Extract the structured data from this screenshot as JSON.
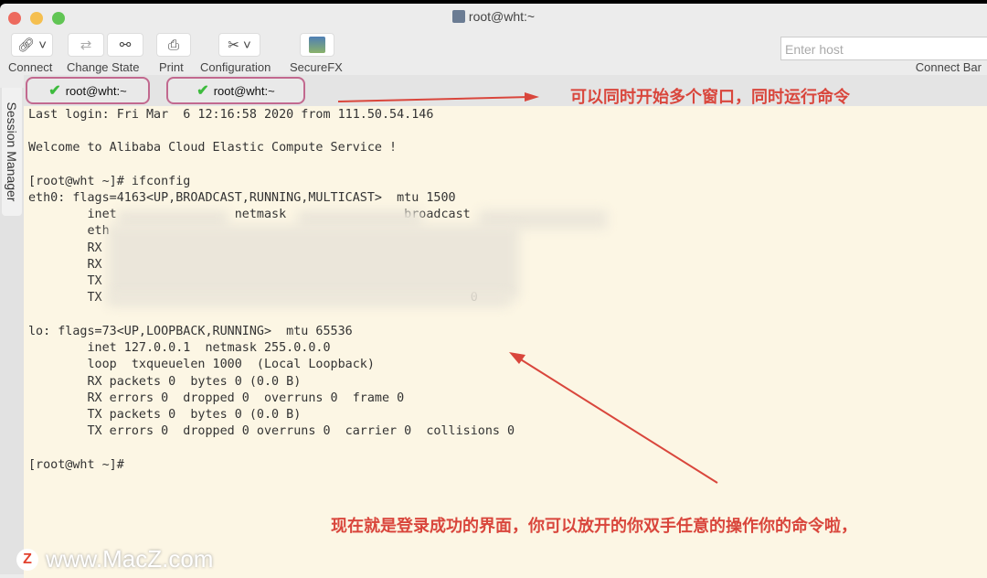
{
  "window": {
    "title": "root@wht:~"
  },
  "toolbar": {
    "items": [
      {
        "label": "Connect",
        "icon": "link-icon"
      },
      {
        "label": "Change State",
        "icon": "swap-icon"
      },
      {
        "label": "Print",
        "icon": "printer-icon"
      },
      {
        "label": "Configuration",
        "icon": "tools-icon"
      },
      {
        "label": "SecureFX",
        "icon": "securefx-icon"
      }
    ],
    "host_placeholder": "Enter host",
    "connect_bar_label": "Connect Bar"
  },
  "tabs": [
    {
      "label": "root@wht:~",
      "status": "connected"
    },
    {
      "label": "root@wht:~",
      "status": "connected"
    }
  ],
  "sidebar": {
    "label": "Session Manager"
  },
  "terminal": {
    "lines": [
      "Last login: Fri Mar  6 12:16:58 2020 from 111.50.54.146",
      "",
      "Welcome to Alibaba Cloud Elastic Compute Service !",
      "",
      "[root@wht ~]# ifconfig",
      "eth0: flags=4163<UP,BROADCAST,RUNNING,MULTICAST>  mtu 1500",
      "        inet                netmask                broadcast",
      "        eth",
      "        RX",
      "        RX",
      "        TX",
      "        TX                                                  0",
      "",
      "lo: flags=73<UP,LOOPBACK,RUNNING>  mtu 65536",
      "        inet 127.0.0.1  netmask 255.0.0.0",
      "        loop  txqueuelen 1000  (Local Loopback)",
      "        RX packets 0  bytes 0 (0.0 B)",
      "        RX errors 0  dropped 0  overruns 0  frame 0",
      "        TX packets 0  bytes 0 (0.0 B)",
      "        TX errors 0  dropped 0 overruns 0  carrier 0  collisions 0",
      "",
      "[root@wht ~]#"
    ]
  },
  "annotations": {
    "tabs_note": "可以同时开始多个窗口，同时运行命令",
    "login_note": "现在就是登录成功的界面，你可以放开的你双手任意的操作你的命令啦，"
  },
  "watermark": "www.MacZ.com",
  "colors": {
    "terminal_bg": "#fcf6e4",
    "annotation": "#d9463c",
    "tab_highlight": "#c2698f"
  }
}
